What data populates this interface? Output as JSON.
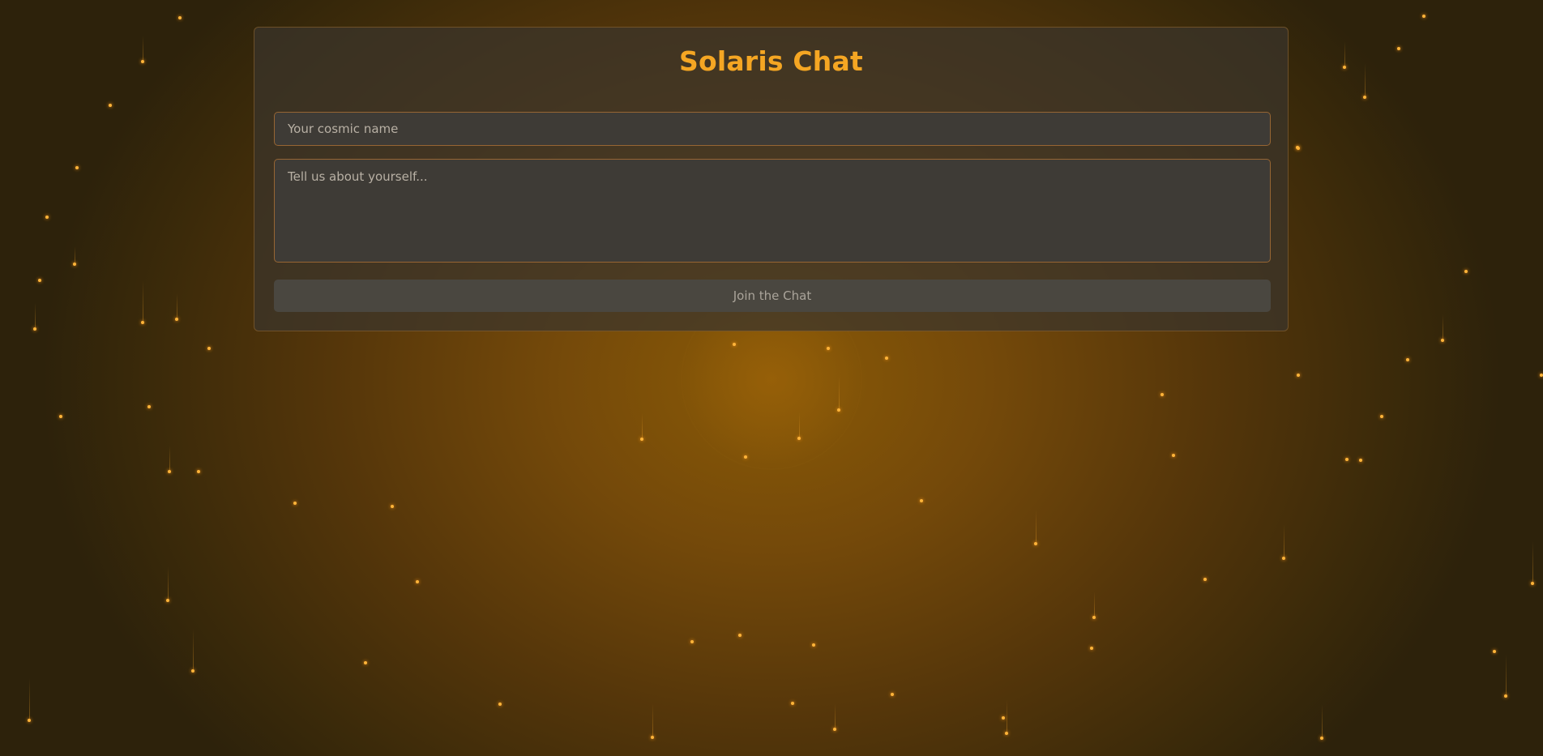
{
  "app": {
    "title": "Solaris Chat"
  },
  "form": {
    "name_placeholder": "Your cosmic name",
    "name_value": "",
    "about_placeholder": "Tell us about yourself...",
    "about_value": "",
    "join_label": "Join the Chat"
  },
  "colors": {
    "accent": "#f5a623",
    "background": "#74490a",
    "panel": "#3a342c",
    "input_border": "#be7832",
    "button_bg": "#4a4740"
  }
}
